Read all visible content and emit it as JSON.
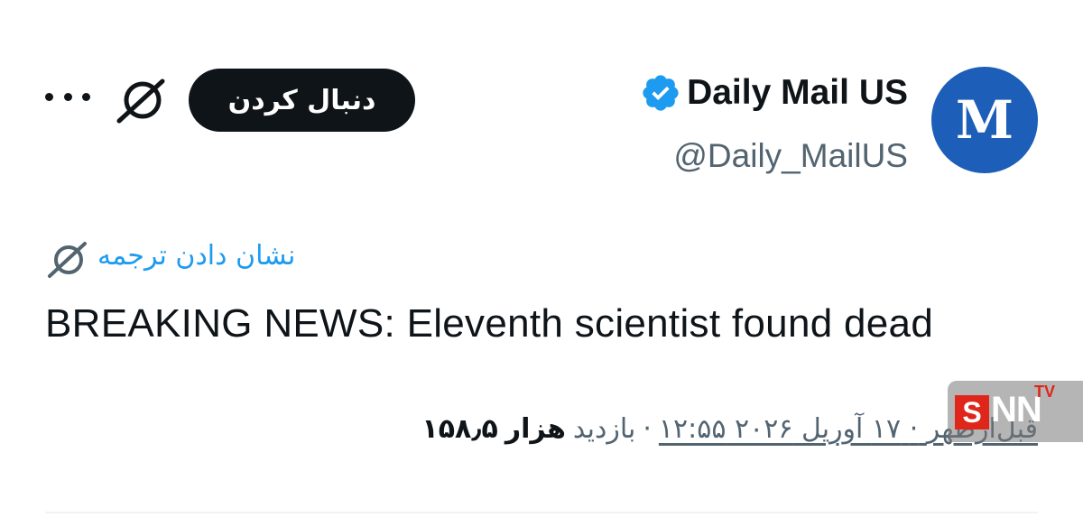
{
  "account": {
    "display_name": "Daily Mail US",
    "handle": "@Daily_MailUS",
    "verified": true,
    "avatar_icon": "daily-mail-logo",
    "avatar_color": "#1c5eb8"
  },
  "actions": {
    "follow_label": "دنبال کردن",
    "grok_icon": "grok-icon",
    "more_icon": "more-options-icon"
  },
  "translate": {
    "label": "نشان دادن ترجمه",
    "icon": "grok-icon"
  },
  "tweet": {
    "text": "BREAKING NEWS: Eleventh scientist found dead"
  },
  "meta": {
    "time": "۱۲:۵۵ ۲۰۲۶ قبل‌ازظهر · ۱۷ آوریل",
    "time_part": "قبل‌ازظهر",
    "date_part": "۱۷ آوریل",
    "year_part": "۲۰۲۶",
    "clock_part": "۱۲:۵۵",
    "views_count": "۱۵۸٫۵",
    "views_unit": "هزار",
    "views_label": "بازدید"
  },
  "watermark": {
    "s": "S",
    "nn": "NN",
    "tv": "TV"
  },
  "colors": {
    "accent": "#1d9bf0",
    "text": "#0f1419",
    "secondary": "#536471",
    "button_bg": "#0f1419"
  }
}
